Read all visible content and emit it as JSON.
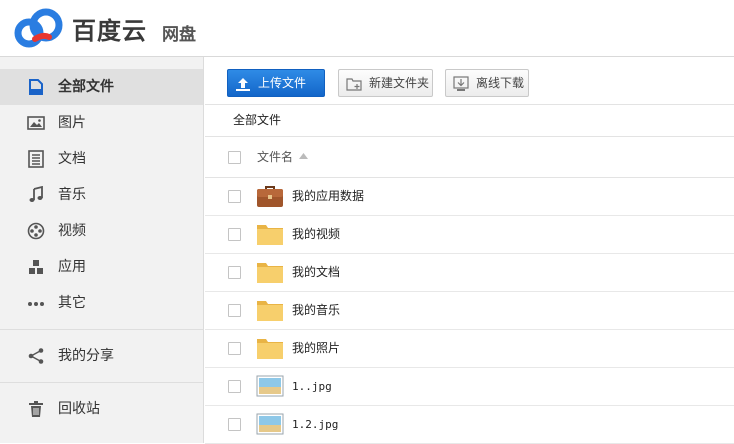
{
  "header": {
    "brand": "百度云",
    "product": "网盘"
  },
  "sidebar": {
    "items": [
      {
        "label": "全部文件",
        "icon": "all-files-icon",
        "active": true
      },
      {
        "label": "图片",
        "icon": "image-icon"
      },
      {
        "label": "文档",
        "icon": "document-icon"
      },
      {
        "label": "音乐",
        "icon": "music-icon"
      },
      {
        "label": "视频",
        "icon": "video-icon"
      },
      {
        "label": "应用",
        "icon": "apps-icon"
      },
      {
        "label": "其它",
        "icon": "more-icon"
      }
    ],
    "share": {
      "label": "我的分享",
      "icon": "share-icon"
    },
    "recycle": {
      "label": "回收站",
      "icon": "trash-icon"
    }
  },
  "toolbar": {
    "upload_label": "上传文件",
    "newfolder_label": "新建文件夹",
    "offline_label": "离线下载"
  },
  "breadcrumb": {
    "current": "全部文件"
  },
  "table": {
    "name_header": "文件名"
  },
  "files": [
    {
      "name": "我的应用数据",
      "type": "briefcase"
    },
    {
      "name": "我的视频",
      "type": "folder"
    },
    {
      "name": "我的文档",
      "type": "folder"
    },
    {
      "name": "我的音乐",
      "type": "folder"
    },
    {
      "name": "我的照片",
      "type": "folder"
    },
    {
      "name": "1..jpg",
      "type": "image"
    },
    {
      "name": "1.2.jpg",
      "type": "image"
    }
  ],
  "colors": {
    "accent": "#1a73d6",
    "sidebar_bg": "#f2f2f2",
    "folder": "#f5c65a"
  }
}
